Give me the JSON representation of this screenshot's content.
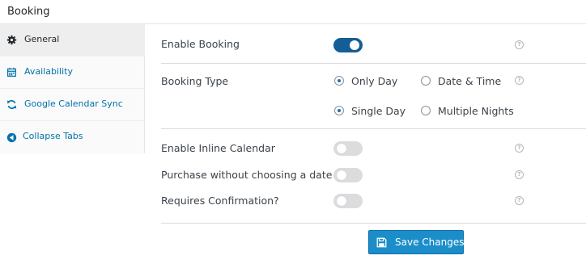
{
  "header": {
    "title": "Booking"
  },
  "sidebar": {
    "tabs": [
      {
        "label": "General",
        "icon": "gear-icon",
        "active": true
      },
      {
        "label": "Availability",
        "icon": "calendar-icon",
        "active": false
      },
      {
        "label": "Google Calendar Sync",
        "icon": "sync-icon",
        "active": false
      },
      {
        "label": "Collapse Tabs",
        "icon": "collapse-icon",
        "active": false
      }
    ]
  },
  "settings": {
    "enable_booking": {
      "label": "Enable Booking",
      "enabled": true,
      "help": "?"
    },
    "booking_type": {
      "label": "Booking Type",
      "help": "?",
      "type_options": [
        {
          "label": "Only Day",
          "checked": true
        },
        {
          "label": "Date & Time",
          "checked": false
        }
      ],
      "duration_options": [
        {
          "label": "Single Day",
          "checked": true
        },
        {
          "label": "Multiple Nights",
          "checked": false
        }
      ]
    },
    "enable_inline_calendar": {
      "label": "Enable Inline Calendar",
      "enabled": false,
      "help": "?"
    },
    "purchase_without_date": {
      "label": "Purchase without choosing a date",
      "enabled": false,
      "help": "?"
    },
    "requires_confirmation": {
      "label": "Requires Confirmation?",
      "enabled": false,
      "help": "?"
    }
  },
  "actions": {
    "save_label": "Save Changes"
  },
  "colors": {
    "accent": "#135e96",
    "link": "#0073aa",
    "button": "#1b8ec9",
    "radio_checked": "#2271b1"
  }
}
